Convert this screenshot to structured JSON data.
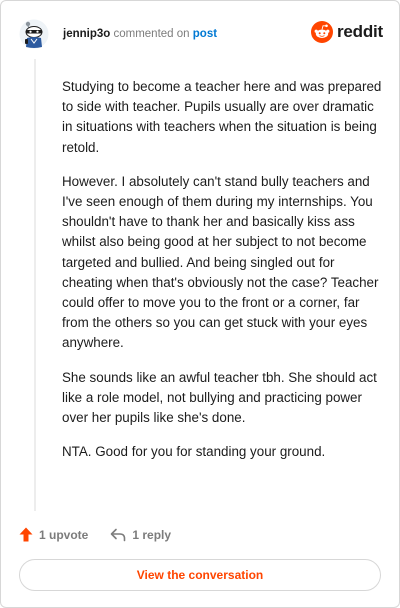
{
  "header": {
    "username": "jennip3o",
    "action": "commented on",
    "link_label": "post",
    "brand": "reddit"
  },
  "comment": {
    "paragraphs": [
      "Studying to become a teacher here and was prepared to side with teacher. Pupils usually are over dramatic in situations with teachers when the situation is being retold.",
      "However. I absolutely can't stand bully teachers and I've seen enough of them during my internships. You shouldn't have to thank her and basically kiss ass whilst also being good at her subject to not become targeted and bullied. And being singled out for cheating when that's obviously not the case? Teacher could offer to move you to the front or a corner, far from the others so you can get stuck with your eyes anywhere.",
      "She sounds like an awful teacher tbh. She should act like a role model, not bullying and practicing power over her pupils like she's done.",
      "NTA. Good for you for standing your ground."
    ]
  },
  "footer": {
    "upvote_label": "1 upvote",
    "reply_label": "1 reply",
    "conversation_button": "View the conversation"
  },
  "colors": {
    "accent": "#ff4500",
    "link": "#0079d3",
    "muted": "#7c7c7c"
  },
  "icons": {
    "avatar": "snoo-avatar-icon",
    "brand": "reddit-logo-icon",
    "upvote": "upvote-arrow-icon",
    "reply": "reply-arrow-icon"
  }
}
